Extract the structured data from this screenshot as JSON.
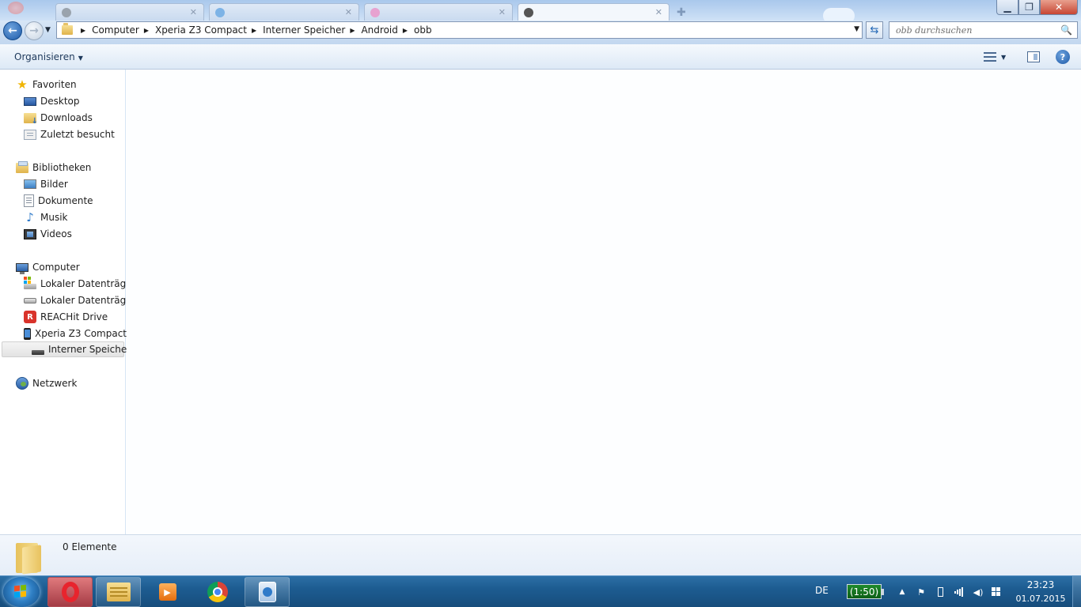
{
  "window": {
    "controls": {
      "minimize": "▁",
      "maximize": "❐",
      "close": "✕"
    }
  },
  "address_bar": {
    "breadcrumbs": [
      "Computer",
      "Xperia Z3 Compact",
      "Interner Speicher",
      "Android",
      "obb"
    ],
    "separator": "▶",
    "dropdown": "▼",
    "refresh_icon": "⇆",
    "search_placeholder": "obb durchsuchen",
    "search_icon": "🔍",
    "back_icon": "←",
    "forward_icon": "→",
    "recent_icon": "▼"
  },
  "command_bar": {
    "organize_label": "Organisieren",
    "organize_caret": "▼",
    "view_caret": "▼",
    "help_icon": "?"
  },
  "nav_pane": {
    "favorites": {
      "header": "Favoriten",
      "items": [
        "Desktop",
        "Downloads",
        "Zuletzt besucht"
      ]
    },
    "libraries": {
      "header": "Bibliotheken",
      "items": [
        "Bilder",
        "Dokumente",
        "Musik",
        "Videos"
      ]
    },
    "computer": {
      "header": "Computer",
      "items": [
        "Lokaler Datenträger",
        "Lokaler Datenträger",
        "REACHit Drive",
        "Xperia Z3 Compact"
      ],
      "selected": "Interner Speicher"
    },
    "network": {
      "header": "Netzwerk"
    },
    "glyphs": {
      "star": "★",
      "music": "♪",
      "reachit": "R"
    }
  },
  "details_pane": {
    "item_count": "0 Elemente"
  },
  "taskbar": {
    "language": "DE",
    "battery": "(1:50)",
    "time": "23:23",
    "date": "01.07.2015",
    "glyphs": {
      "expand": "▲",
      "flag": "⚑",
      "volume": "◀)",
      "media": "▶"
    },
    "apps": [
      "opera",
      "windows-explorer",
      "media-player",
      "chrome",
      "pc-companion"
    ]
  },
  "colors": {
    "taskbar": "#1d5c91",
    "accent": "#2b6fc3",
    "close_button": "#c74634"
  }
}
